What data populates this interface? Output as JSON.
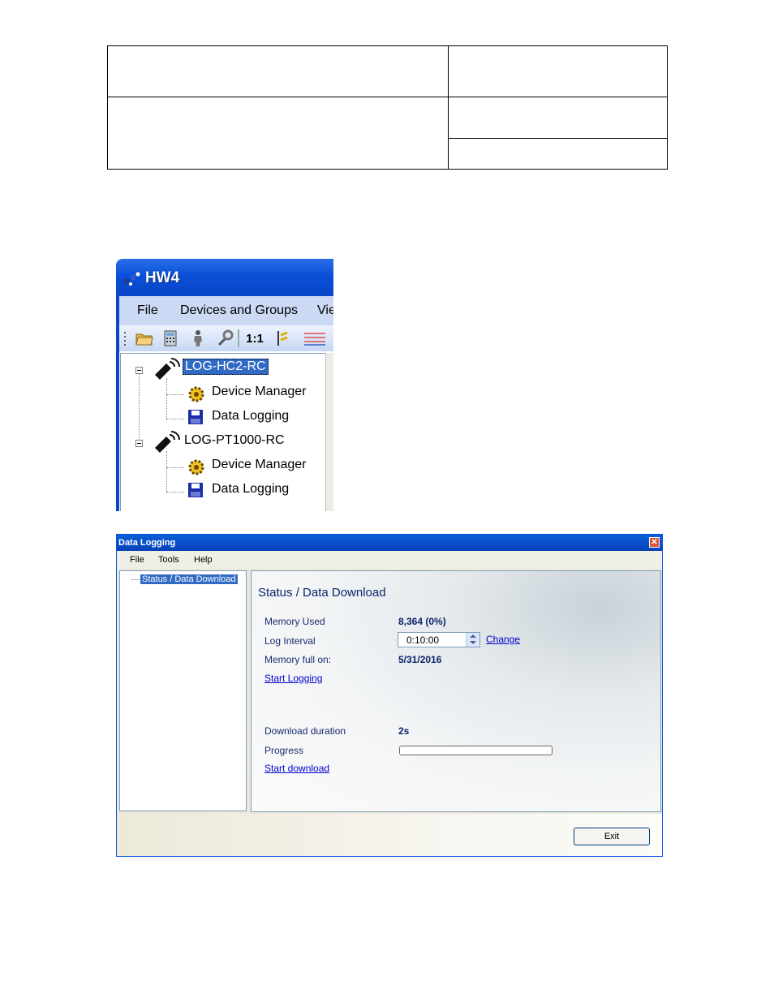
{
  "hw4": {
    "title": "HW4",
    "menu": [
      "File",
      "Devices and Groups",
      "Vie"
    ],
    "toolbar": {
      "ratio_label": "1:1"
    },
    "tree": [
      {
        "label": "LOG-HC2-RC",
        "selected": true
      },
      {
        "label": "Device Manager"
      },
      {
        "label": "Data Logging"
      },
      {
        "label": "LOG-PT1000-RC",
        "selected": false
      },
      {
        "label": "Device Manager"
      },
      {
        "label": "Data Logging"
      }
    ]
  },
  "dialog": {
    "title": "Data Logging",
    "menu": [
      "File",
      "Tools",
      "Help"
    ],
    "tree_item": "Status / Data Download",
    "heading": "Status / Data Download",
    "memory_used_label": "Memory Used",
    "memory_used_value": "8,364 (0%)",
    "log_interval_label": "Log Interval",
    "log_interval_value": "0:10:00",
    "change_link": "Change",
    "memory_full_label": "Memory full on:",
    "memory_full_value": "5/31/2016",
    "start_logging_link": "Start Logging",
    "download_duration_label": "Download duration",
    "download_duration_value": "2s",
    "progress_label": "Progress",
    "progress_fraction": 0,
    "start_download_link": "Start download",
    "exit_label": "Exit"
  }
}
